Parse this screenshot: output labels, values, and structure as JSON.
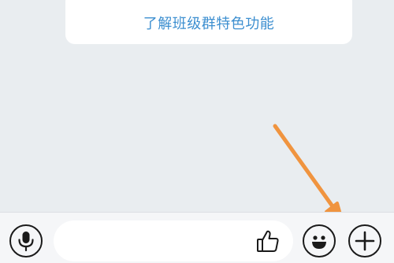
{
  "chat": {
    "feature_card": {
      "link_label": "了解班级群特色功能"
    }
  },
  "input_bar": {
    "message_input": {
      "value": "",
      "placeholder": ""
    },
    "icons": {
      "voice": "microphone-icon",
      "like": "thumbs-up-icon",
      "emoji": "smiley-icon",
      "more": "plus-icon"
    }
  },
  "colors": {
    "background": "#e9edf0",
    "link": "#3d8fd0",
    "arrow": "#f0943f",
    "icon_stroke": "#1a1a1a"
  }
}
